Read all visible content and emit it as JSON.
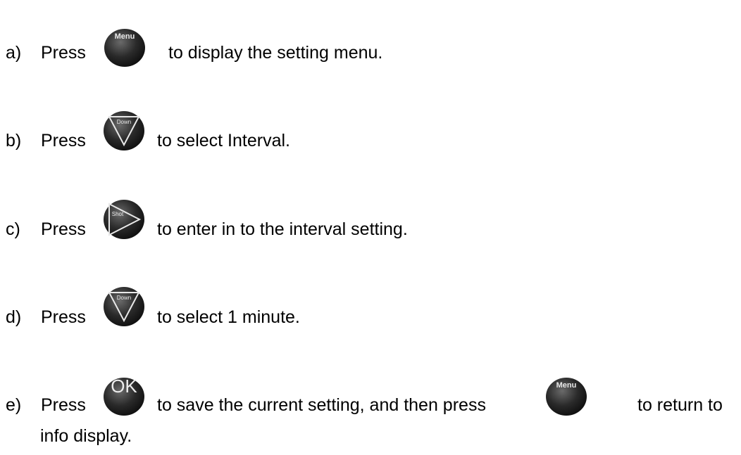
{
  "steps": [
    {
      "letter": "a)",
      "press": "Press",
      "text": "to display the setting menu.",
      "button": "Menu"
    },
    {
      "letter": "b)",
      "press": "Press",
      "text": "to select Interval.",
      "button": "Down"
    },
    {
      "letter": "c)",
      "press": "Press",
      "text": "to enter in to the interval setting.",
      "button": "Shot"
    },
    {
      "letter": "d)",
      "press": "Press",
      "text": "to select 1 minute.",
      "button": "Down"
    },
    {
      "letter": "e)",
      "press": "Press",
      "text": "to save the current setting, and then press",
      "text2": "to return to",
      "continuation": "info display.",
      "button": "OK",
      "button2": "Menu"
    }
  ],
  "colors": {
    "button_dark": "#1a1a1a",
    "button_light": "#5a5a5a",
    "button_label": "#e8e8e8"
  },
  "icons": {
    "menu": "menu-button-icon",
    "down": "down-button-icon",
    "shot": "shot-button-icon",
    "ok": "ok-button-icon"
  }
}
